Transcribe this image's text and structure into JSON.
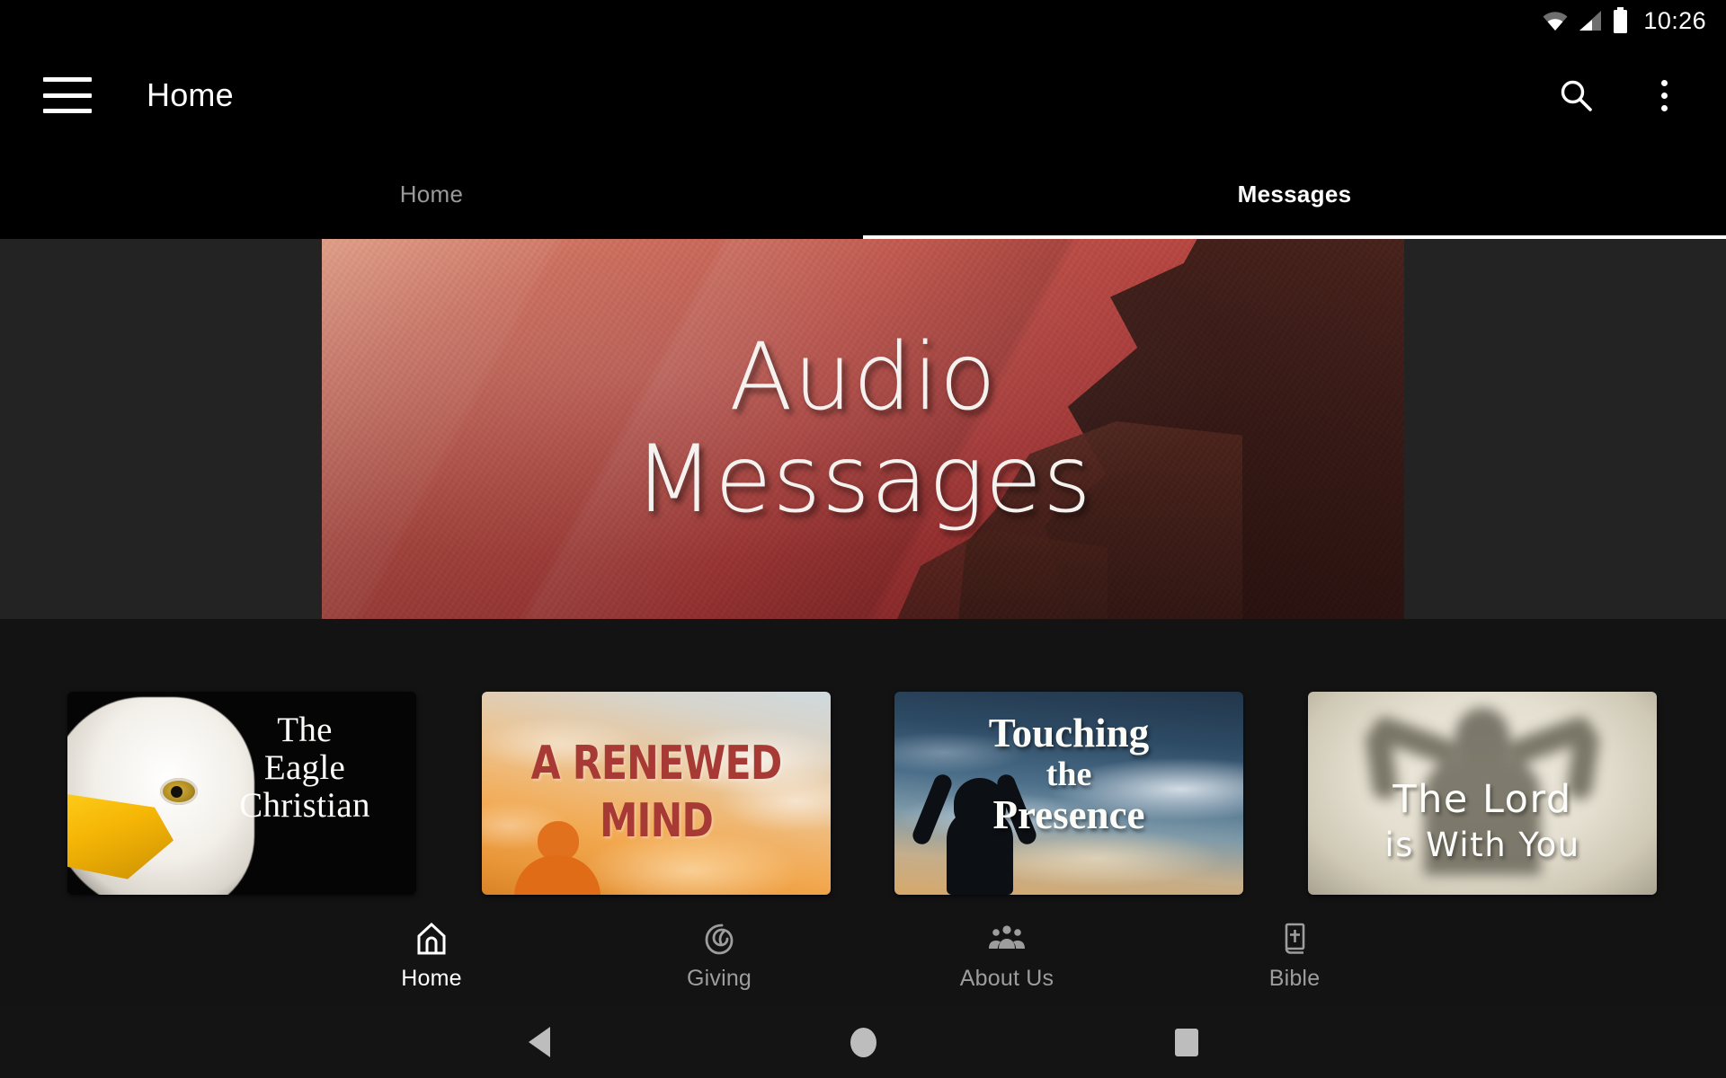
{
  "status_bar": {
    "time": "10:26",
    "icons": [
      "wifi-icon",
      "cellular-signal-icon",
      "battery-full-icon"
    ]
  },
  "app_bar": {
    "menu_icon": "hamburger-menu-icon",
    "title": "Home",
    "search_icon": "search-icon",
    "overflow_icon": "more-vertical-icon"
  },
  "tabs": [
    {
      "label": "Home",
      "active": false
    },
    {
      "label": "Messages",
      "active": true
    }
  ],
  "hero": {
    "line1": "Audio",
    "line2": "Messages",
    "accent_color": "#b93f3e",
    "rock_color": "#3a1c18"
  },
  "cards": [
    {
      "name": "the-eagle-christian",
      "title_lines": [
        "The",
        "Eagle",
        "Christian"
      ],
      "full_title": "The Eagle Christian"
    },
    {
      "name": "a-renewed-mind",
      "title_lines": [
        "A RENEWED",
        "MIND"
      ],
      "full_title": "A RENEWED MIND"
    },
    {
      "name": "touching-the-presence",
      "title_lines": [
        "Touching",
        "the",
        "Presence"
      ],
      "full_title": "Touching the Presence"
    },
    {
      "name": "the-lord-is-with-you",
      "title_lines": [
        "The Lord",
        "is With You"
      ],
      "full_title": "The Lord is With You"
    }
  ],
  "bottom_nav": [
    {
      "label": "Home",
      "icon": "home-icon",
      "active": true
    },
    {
      "label": "Giving",
      "icon": "giving-hand-icon",
      "active": false
    },
    {
      "label": "About Us",
      "icon": "people-group-icon",
      "active": false
    },
    {
      "label": "Bible",
      "icon": "bible-book-icon",
      "active": false
    }
  ],
  "system_nav": {
    "back": "back-triangle-icon",
    "home": "home-circle-icon",
    "recents": "recents-square-icon"
  },
  "colors": {
    "app_bar_bg": "#000000",
    "hero_bg": "#232323",
    "cards_bg": "#131314",
    "nav_bg": "#131314",
    "sysnav_bg": "#141414",
    "active_text": "#ffffff",
    "idle_text": "#9d9d9d"
  }
}
